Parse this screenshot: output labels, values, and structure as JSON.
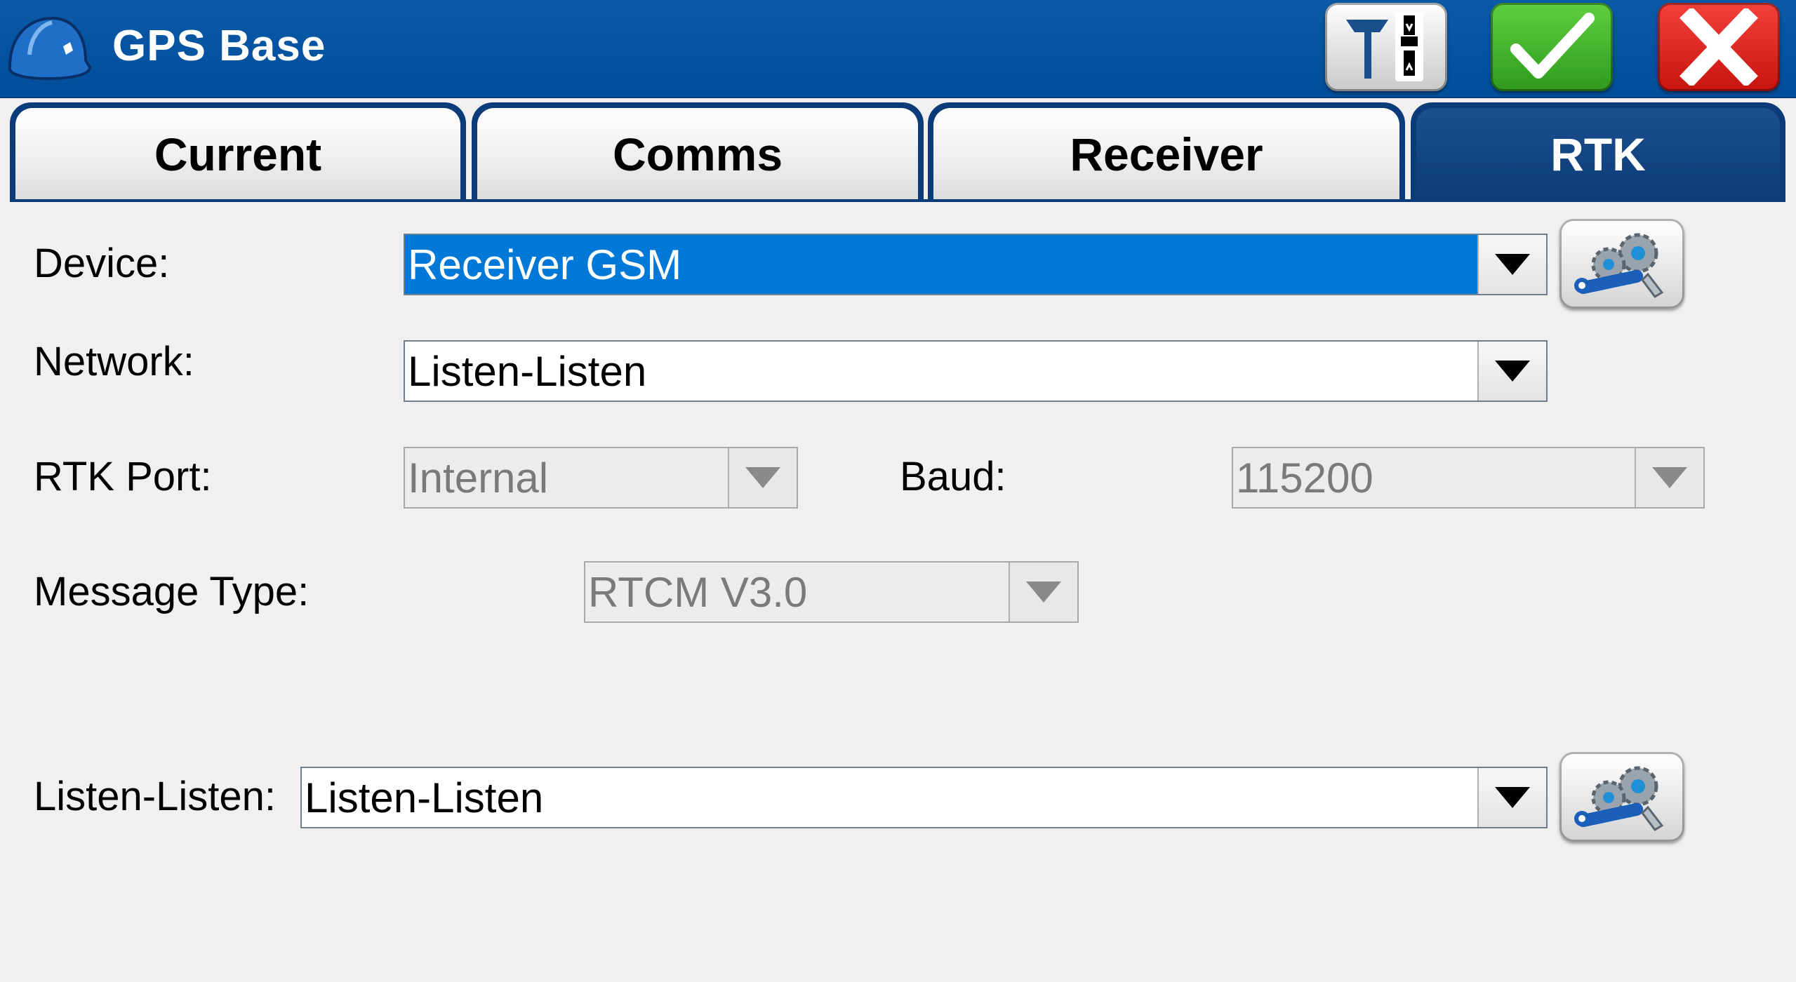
{
  "title": "GPS Base",
  "tabs": [
    "Current",
    "Comms",
    "Receiver",
    "RTK"
  ],
  "active_tab": "RTK",
  "form": {
    "device": {
      "label": "Device:",
      "value": "Receiver GSM"
    },
    "network": {
      "label": "Network:",
      "value": "Listen-Listen"
    },
    "rtk_port": {
      "label": "RTK Port:",
      "value": "Internal"
    },
    "baud": {
      "label": "Baud:",
      "value": "115200"
    },
    "message_type": {
      "label": "Message Type:",
      "value": "RTCM V3.0"
    },
    "listen": {
      "label": "Listen-Listen:",
      "value": "Listen-Listen"
    }
  },
  "icons": {
    "app": "hard-hat-icon",
    "gps": "gps-antenna-icon",
    "ok": "checkmark-icon",
    "cancel": "close-icon",
    "settings": "gears-wrench-icon"
  },
  "colors": {
    "titlebar": "#004e9a",
    "tab_active": "#0b3b78",
    "selection": "#0078d7",
    "ok": "#3aa82a",
    "cancel": "#d81e18"
  }
}
